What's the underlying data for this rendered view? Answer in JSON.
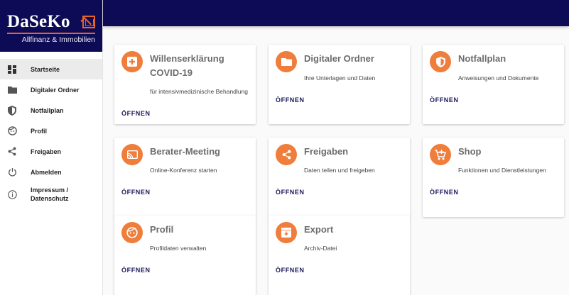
{
  "brand": {
    "name": "DaSeKo",
    "tagline": "Allfinanz & Immobilien"
  },
  "nav": [
    {
      "label": "Startseite",
      "icon": "dashboard-icon",
      "active": true
    },
    {
      "label": "Digitaler Ordner",
      "icon": "folder-icon"
    },
    {
      "label": "Notfallplan",
      "icon": "shield-icon"
    },
    {
      "label": "Profil",
      "icon": "face-icon"
    },
    {
      "label": "Freigaben",
      "icon": "share-icon"
    },
    {
      "label": "Abmelden",
      "icon": "power-icon"
    },
    {
      "label": "Impressum / Datenschutz",
      "icon": "info-icon"
    }
  ],
  "cards": [
    {
      "title": "Willenserklärung COVID-19",
      "desc": "für intensivmedizinische Behandlung",
      "action": "ÖFFNEN",
      "icon": "medical-cross-icon"
    },
    {
      "title": "Digitaler Ordner",
      "desc": "Ihre Unterlagen und Daten",
      "action": "ÖFFNEN",
      "icon": "folder-icon"
    },
    {
      "title": "Notfallplan",
      "desc": "Anweisungen und Dokumente",
      "action": "ÖFFNEN",
      "icon": "shield-icon"
    },
    {
      "title": "Berater-Meeting",
      "desc": "Online-Konferenz starten",
      "action": "ÖFFNEN",
      "icon": "cast-icon"
    },
    {
      "title": "Freigaben",
      "desc": "Daten teilen und freigeben",
      "action": "ÖFFNEN",
      "icon": "share-icon"
    },
    {
      "title": "Shop",
      "desc": "Funktionen und Dienstleistungen",
      "action": "ÖFFNEN",
      "icon": "cart-icon"
    },
    {
      "title": "Profil",
      "desc": "Profildaten verwalten",
      "action": "ÖFFNEN",
      "icon": "face-icon"
    },
    {
      "title": "Export",
      "desc": "Archiv-Datei",
      "action": "ÖFFNEN",
      "icon": "archive-icon"
    }
  ],
  "colors": {
    "navy": "#0d0b55",
    "accent": "#ef7d3c"
  }
}
